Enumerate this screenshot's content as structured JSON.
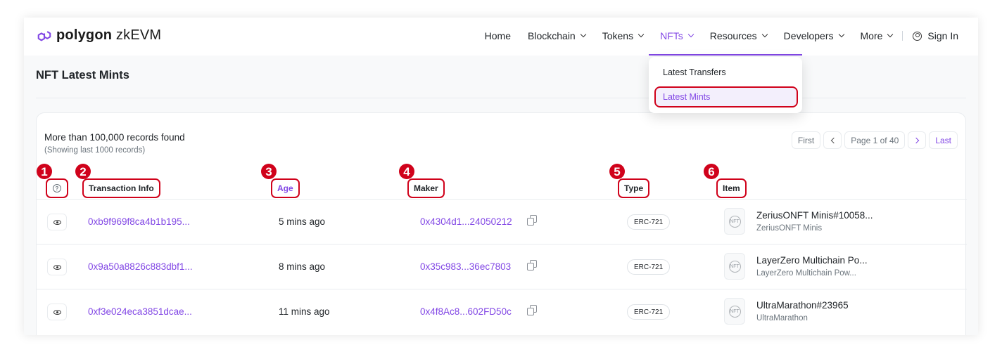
{
  "brand": {
    "name_bold": "polygon",
    "name_rest": " zkEVM",
    "accent_color": "#8247e5",
    "logo_icon": "polygon-logo-icon"
  },
  "nav": {
    "items": [
      {
        "label": "Home",
        "has_dropdown": false
      },
      {
        "label": "Blockchain",
        "has_dropdown": true
      },
      {
        "label": "Tokens",
        "has_dropdown": true
      },
      {
        "label": "NFTs",
        "has_dropdown": true,
        "active": true
      },
      {
        "label": "Resources",
        "has_dropdown": true
      },
      {
        "label": "Developers",
        "has_dropdown": true
      },
      {
        "label": "More",
        "has_dropdown": true
      }
    ],
    "sign_in": "Sign In",
    "sign_in_icon": "user-circle-icon"
  },
  "dropdown": {
    "items": [
      "Latest Transfers",
      "Latest Mints"
    ],
    "active_index": 1
  },
  "page": {
    "title": "NFT Latest Mints"
  },
  "summary": {
    "records": "More than 100,000 records found",
    "showing": "(Showing last 1000 records)"
  },
  "pagination": {
    "first": "First",
    "page_info": "Page 1 of 40",
    "last": "Last"
  },
  "table": {
    "help_icon": "question-circle-icon",
    "help_glyph": "?",
    "columns": [
      "Transaction Info",
      "Age",
      "Maker",
      "Type",
      "Item"
    ],
    "rows": [
      {
        "tx": "0xb9f969f8ca4b1b195...",
        "age": "5 mins ago",
        "maker": "0x4304d1...24050212",
        "type": "ERC-721",
        "item_name": "ZeriusONFT Minis#10058...",
        "item_collection": "ZeriusONFT Minis",
        "item_placeholder": "NFT"
      },
      {
        "tx": "0x9a50a8826c883dbf1...",
        "age": "8 mins ago",
        "maker": "0x35c983...36ec7803",
        "type": "ERC-721",
        "item_name": "LayerZero Multichain Po...",
        "item_collection": "LayerZero Multichain Pow...",
        "item_placeholder": "NFT"
      },
      {
        "tx": "0xf3e024eca3851dcae...",
        "age": "11 mins ago",
        "maker": "0x4f8Ac8...602FD50c",
        "type": "ERC-721",
        "item_name": "UltraMarathon#23965",
        "item_collection": "UltraMarathon",
        "item_placeholder": "NFT"
      }
    ]
  },
  "annotations": {
    "labels": [
      "1",
      "2",
      "3",
      "4",
      "5",
      "6"
    ],
    "color": "#d0021b"
  }
}
